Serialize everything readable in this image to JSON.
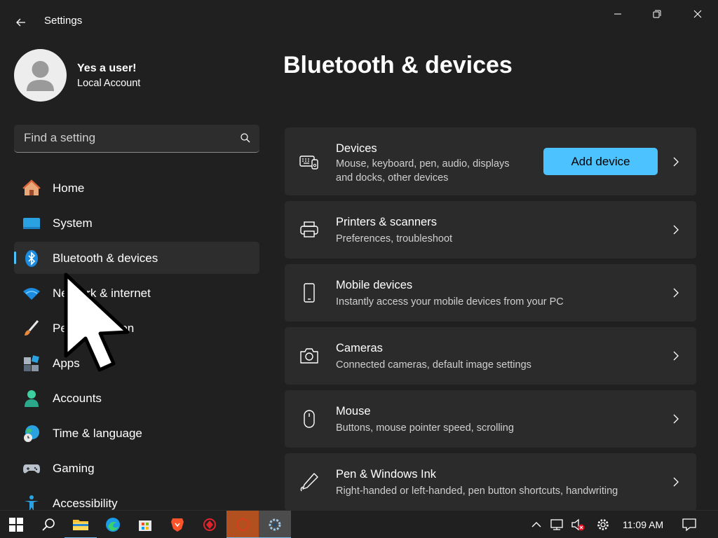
{
  "window": {
    "title": "Settings"
  },
  "user": {
    "name": "Yes a user!",
    "account_type": "Local Account"
  },
  "search": {
    "placeholder": "Find a setting"
  },
  "sidebar": {
    "items": [
      {
        "label": "Home",
        "icon": "home-icon"
      },
      {
        "label": "System",
        "icon": "system-icon"
      },
      {
        "label": "Bluetooth & devices",
        "icon": "bluetooth-icon",
        "selected": true
      },
      {
        "label": "Network & internet",
        "icon": "wifi-icon"
      },
      {
        "label": "Personalization",
        "icon": "brush-icon"
      },
      {
        "label": "Apps",
        "icon": "apps-icon"
      },
      {
        "label": "Accounts",
        "icon": "accounts-icon"
      },
      {
        "label": "Time & language",
        "icon": "globe-clock-icon"
      },
      {
        "label": "Gaming",
        "icon": "gamepad-icon"
      },
      {
        "label": "Accessibility",
        "icon": "accessibility-icon"
      }
    ]
  },
  "main": {
    "title": "Bluetooth & devices",
    "cards": [
      {
        "title": "Devices",
        "description_line1": "Mouse, keyboard, pen, audio, displays",
        "description_line2": "and docks, other devices",
        "button": "Add device",
        "icon": "devices-icon"
      },
      {
        "title": "Printers & scanners",
        "description": "Preferences, troubleshoot",
        "icon": "printer-icon"
      },
      {
        "title": "Mobile devices",
        "description": "Instantly access your mobile devices from your PC",
        "icon": "phone-icon"
      },
      {
        "title": "Cameras",
        "description": "Connected cameras, default image settings",
        "icon": "camera-icon"
      },
      {
        "title": "Mouse",
        "description": "Buttons, mouse pointer speed, scrolling",
        "icon": "mouse-icon"
      },
      {
        "title": "Pen & Windows Ink",
        "description": "Right-handed or left-handed, pen button shortcuts, handwriting",
        "icon": "pen-icon"
      }
    ]
  },
  "taskbar": {
    "clock": "11:09 AM"
  },
  "colors": {
    "accent": "#4cc2ff",
    "background": "#202020",
    "card": "#2b2b2b"
  }
}
